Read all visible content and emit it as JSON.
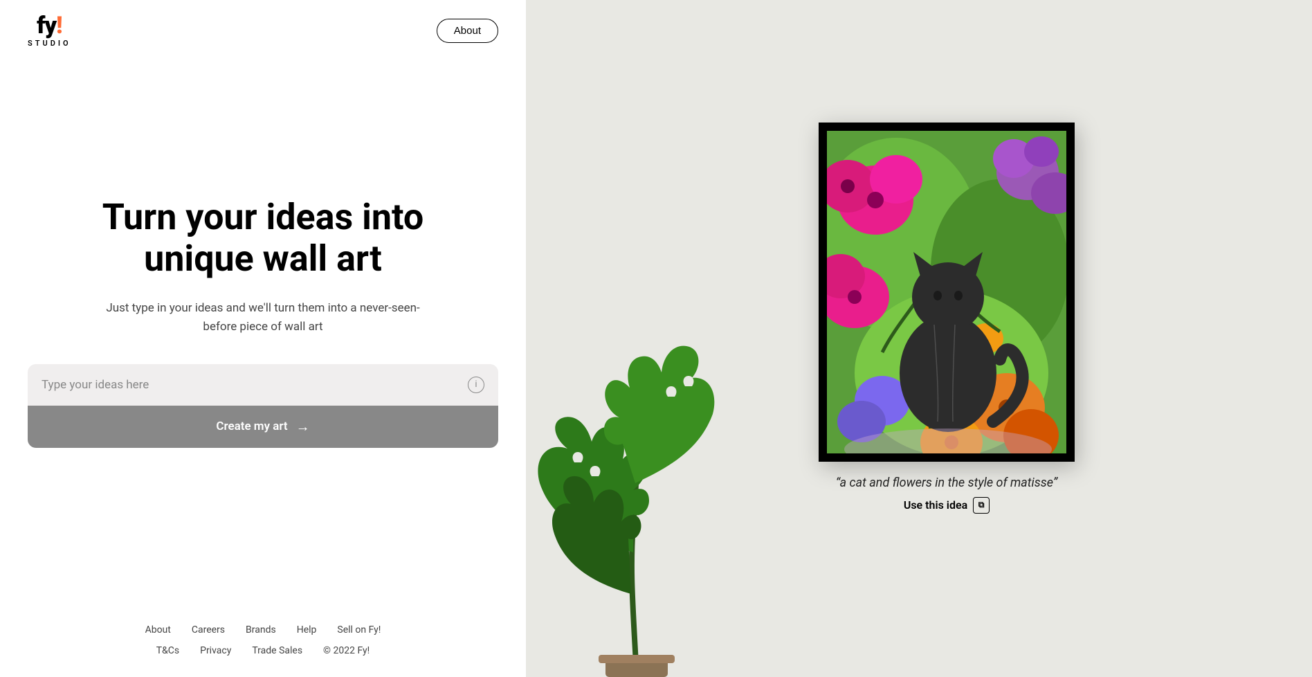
{
  "header": {
    "logo": {
      "mark": "fy!",
      "subtitle": "STUDIO"
    },
    "about_button": "About"
  },
  "hero": {
    "title": "Turn your ideas into unique wall art",
    "subtitle": "Just type in your ideas and we'll turn them into a never-seen-before piece of wall art"
  },
  "input": {
    "placeholder": "Type your ideas here",
    "info_icon": "ℹ",
    "create_button": "Create my art",
    "arrow": "→"
  },
  "footer": {
    "links": [
      {
        "label": "About"
      },
      {
        "label": "Careers"
      },
      {
        "label": "Brands"
      },
      {
        "label": "Help"
      },
      {
        "label": "Sell on Fy!"
      }
    ],
    "bottom_links": [
      {
        "label": "T&Cs"
      },
      {
        "label": "Privacy"
      },
      {
        "label": "Trade Sales"
      }
    ],
    "copyright": "© 2022 Fy!"
  },
  "art": {
    "caption": "“a cat and flowers in the style of matisse”",
    "use_idea_label": "Use this idea"
  },
  "colors": {
    "accent": "#ff6b35",
    "background_right": "#e8e8e3",
    "button_grey": "#888888"
  }
}
